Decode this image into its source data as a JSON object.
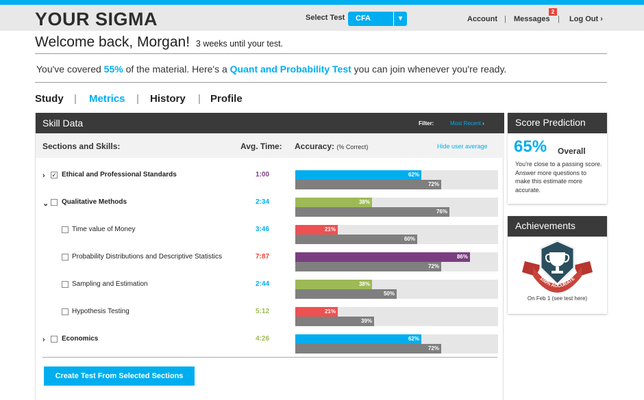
{
  "brand": {
    "logo": "YOUR SIGMA",
    "accent": "#00aeef"
  },
  "header": {
    "select_label": "Select Test",
    "select_value": "CFA",
    "account": "Account",
    "messages": "Messages",
    "messages_badge": "2",
    "logout": "Log Out"
  },
  "welcome": {
    "greeting": "Welcome back, Morgan!",
    "countdown": "3 weeks until your test."
  },
  "covered": {
    "prefix": "You've covered",
    "pct": "55%",
    "mid": "of the material. Here's a",
    "test_link": "Quant and Probability Test",
    "suffix": "you can join whenever you're ready."
  },
  "tabs": [
    "Study",
    "Metrics",
    "History",
    "Profile"
  ],
  "skill_panel": {
    "title": "Skill Data",
    "filter_label": "Filter:",
    "filter_value": "Most Recent",
    "col_sections": "Sections and Skills:",
    "col_time": "Avg. Time:",
    "col_accuracy": "Accuracy:",
    "col_accuracy_unit": "(% Correct)",
    "hide_avg": "Hide user average",
    "rows": [
      {
        "label": "Ethical and Professional Standards",
        "expand": "›",
        "checked": "✓",
        "time": "1:00",
        "time_color": "#7a3e80",
        "user": 62,
        "user_label": "62%",
        "user_color": "#00aeef",
        "avg": 72,
        "avg_label": "72%"
      },
      {
        "label": "Qualitative Methods",
        "expand": "⌄",
        "checked": "",
        "time": "2:34",
        "time_color": "#00aeef",
        "user": 38,
        "user_label": "38%",
        "user_color": "#9dba56",
        "avg": 76,
        "avg_label": "76%"
      },
      {
        "label": "Time value of Money",
        "expand": "",
        "checked": "",
        "time": "3:46",
        "time_color": "#00aeef",
        "user": 21,
        "user_label": "21%",
        "user_color": "#ee5151",
        "avg": 60,
        "avg_label": "60%"
      },
      {
        "label": "Probability Distributions and Descriptive Statistics",
        "expand": "",
        "checked": "",
        "time": "7:87",
        "time_color": "#e8463b",
        "user": 86,
        "user_label": "86%",
        "user_color": "#7a3e80",
        "avg": 72,
        "avg_label": "72%"
      },
      {
        "label": "Sampling and Estimation",
        "expand": "",
        "checked": "",
        "time": "2:44",
        "time_color": "#00aeef",
        "user": 38,
        "user_label": "38%",
        "user_color": "#9dba56",
        "avg": 50,
        "avg_label": "50%"
      },
      {
        "label": "Hypothesis Testing",
        "expand": "",
        "checked": "",
        "time": "5:12",
        "time_color": "#9dba56",
        "user": 21,
        "user_label": "21%",
        "user_color": "#ee5151",
        "avg": 39,
        "avg_label": "39%"
      },
      {
        "label": "Economics",
        "expand": "›",
        "checked": "",
        "time": "4:26",
        "time_color": "#9dba56",
        "user": 62,
        "user_label": "62%",
        "user_color": "#00aeef",
        "avg": 72,
        "avg_label": "72%"
      }
    ],
    "create_button": "Create Test From Selected Sections"
  },
  "score_prediction": {
    "title": "Score Prediction",
    "pct": "65%",
    "overall": "Overall",
    "text": "You're close to a passing score. Answer more questions to make this estimate more accurate."
  },
  "achievements": {
    "title": "Achievements",
    "badge_text": "100% ACCURATE",
    "date": "On Feb 1 (see test here)"
  }
}
